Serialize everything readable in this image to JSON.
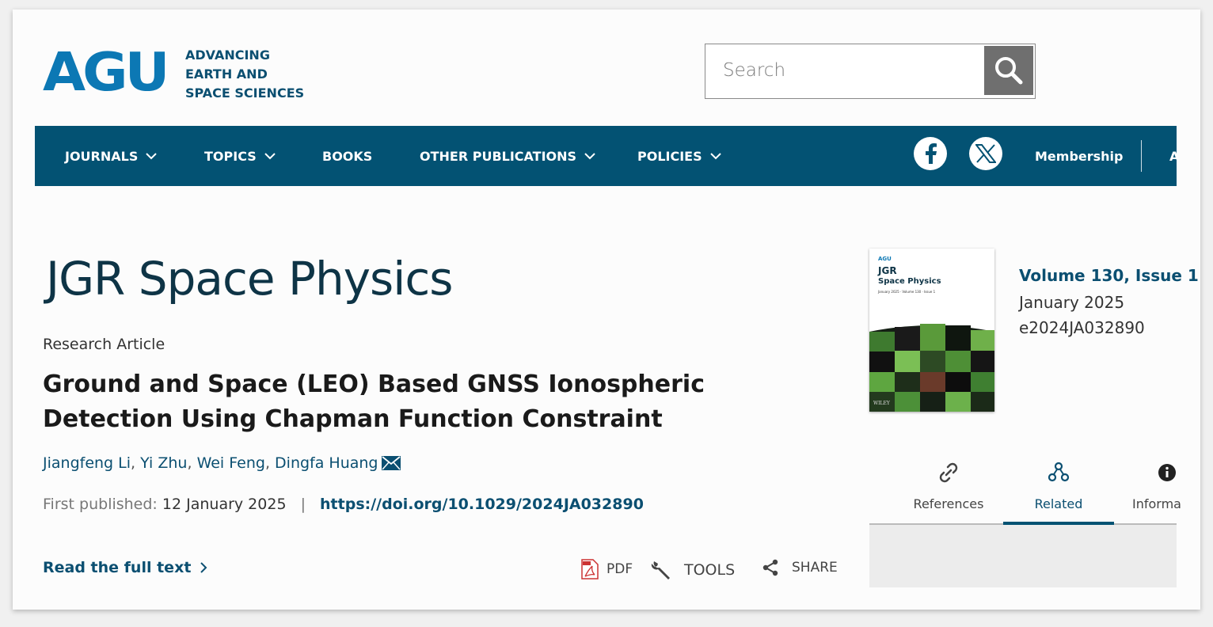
{
  "header": {
    "logo_text": "AGU",
    "tagline": [
      "ADVANCING",
      "EARTH AND",
      "SPACE SCIENCES"
    ],
    "search_placeholder": "Search"
  },
  "nav": {
    "items": [
      {
        "label": "JOURNALS",
        "dropdown": true
      },
      {
        "label": "TOPICS",
        "dropdown": true
      },
      {
        "label": "BOOKS",
        "dropdown": false
      },
      {
        "label": "OTHER PUBLICATIONS",
        "dropdown": true
      },
      {
        "label": "POLICIES",
        "dropdown": true
      }
    ],
    "social": [
      "facebook-icon",
      "x-icon"
    ],
    "membership": "Membership",
    "cut_item": "A"
  },
  "article": {
    "journal": "JGR Space Physics",
    "type": "Research Article",
    "title": "Ground and Space (LEO) Based GNSS Ionospheric Detection Using Chapman Function Constraint",
    "authors": [
      "Jiangfeng Li",
      "Yi Zhu",
      "Wei Feng",
      "Dingfa Huang"
    ],
    "first_published_label": "First published:",
    "first_published": "12 January 2025",
    "doi": "https://doi.org/10.1029/2024JA032890",
    "read_full": "Read the full text"
  },
  "tools": {
    "pdf": "PDF",
    "tools": "TOOLS",
    "share": "SHARE"
  },
  "issue": {
    "cover_agu": "AGU",
    "cover_jgr": "JGR",
    "cover_subtitle": "Space Physics",
    "cover_date": "January 2025 · Volume 130 · Issue 1",
    "cover_publisher": "WILEY",
    "volume": "Volume 130, Issue 1",
    "date": "January 2025",
    "id": "e2024JA032890"
  },
  "tabs": [
    {
      "label": "References",
      "icon": "link-icon"
    },
    {
      "label": "Related",
      "icon": "related-nodes-icon"
    },
    {
      "label": "Informa",
      "icon": "info-icon"
    }
  ],
  "colors": {
    "brand_navy": "#035273",
    "link_blue": "#0b4f71",
    "agu_blue": "#0c78b4"
  }
}
